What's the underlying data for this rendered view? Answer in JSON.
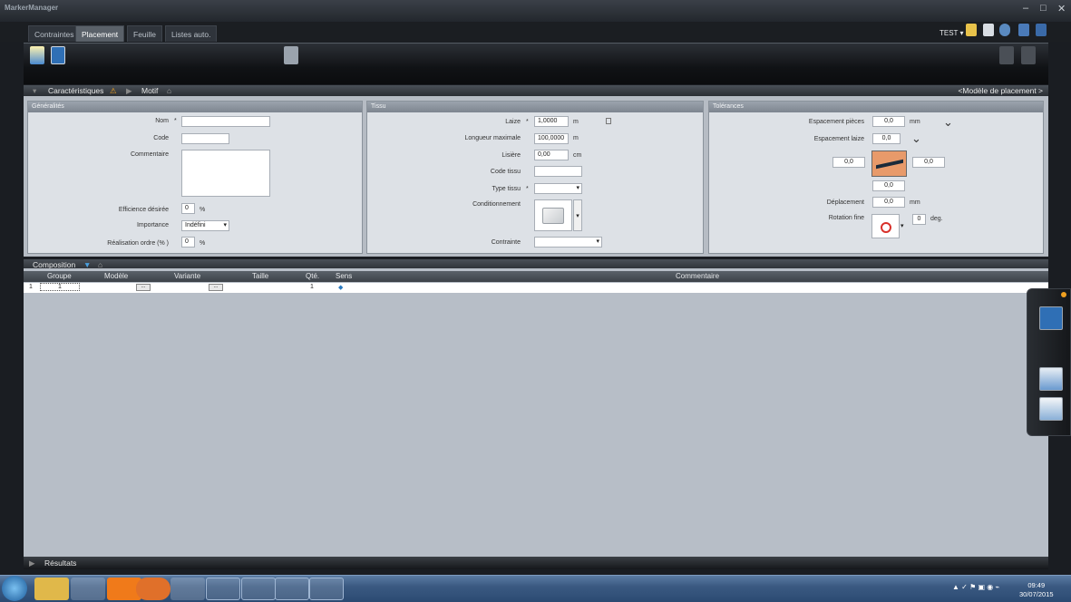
{
  "app": {
    "title": "MarkerManager",
    "user": "TEST"
  },
  "tabs": [
    "Contraintes",
    "Placement",
    "Feuille",
    "Listes auto."
  ],
  "section_caract": {
    "label": "Caractéristiques",
    "motif": "Motif",
    "right_link": "<Modèle de placement >"
  },
  "generalites": {
    "title": "Généralités",
    "nom_label": "Nom",
    "code_label": "Code",
    "commentaire_label": "Commentaire",
    "efficience_label": "Efficience désirée",
    "efficience_value": "0",
    "efficience_unit": "%",
    "importance_label": "Importance",
    "importance_value": "Indéfini",
    "realisation_label": "Réalisation ordre (% )",
    "realisation_value": "0",
    "realisation_unit": "%"
  },
  "tissu": {
    "title": "Tissu",
    "laize_label": "Laize",
    "laize_value": "1,0000",
    "laize_unit": "m",
    "longueur_label": "Longueur maximale",
    "longueur_value": "100,0000",
    "longueur_unit": "m",
    "lisiere_label": "Lisière",
    "lisiere_value": "0,00",
    "lisiere_unit": "cm",
    "code_tissu_label": "Code tissu",
    "type_tissu_label": "Type tissu",
    "conditionnement_label": "Conditionnement",
    "contrainte_label": "Contrainte"
  },
  "tolerances": {
    "title": "Tolérances",
    "esp_pieces_label": "Espacement pièces",
    "esp_pieces_value": "0,0",
    "esp_pieces_unit": "mm",
    "esp_laize_label": "Espacement laize",
    "esp_laize_value": "0,0",
    "left_value": "0,0",
    "right_value": "0,0",
    "bottom_value": "0,0",
    "deplacement_label": "Déplacement",
    "deplacement_value": "0,0",
    "deplacement_unit": "mm",
    "rotation_label": "Rotation fine",
    "rotation_value": "0",
    "rotation_unit": "deg."
  },
  "composition": {
    "label": "Composition",
    "columns": [
      "Groupe",
      "Modèle",
      "Variante",
      "Taille",
      "Qté.",
      "Sens",
      "Commentaire"
    ],
    "row": {
      "index": "1",
      "groupe": "1",
      "ellipsis": "...",
      "qte": "1"
    }
  },
  "results": {
    "label": "Résultats"
  },
  "clock": {
    "time": "09:49",
    "date": "30/07/2015"
  },
  "colors": {
    "accent": "#f0a020",
    "taskbar": "#3b5a82"
  }
}
